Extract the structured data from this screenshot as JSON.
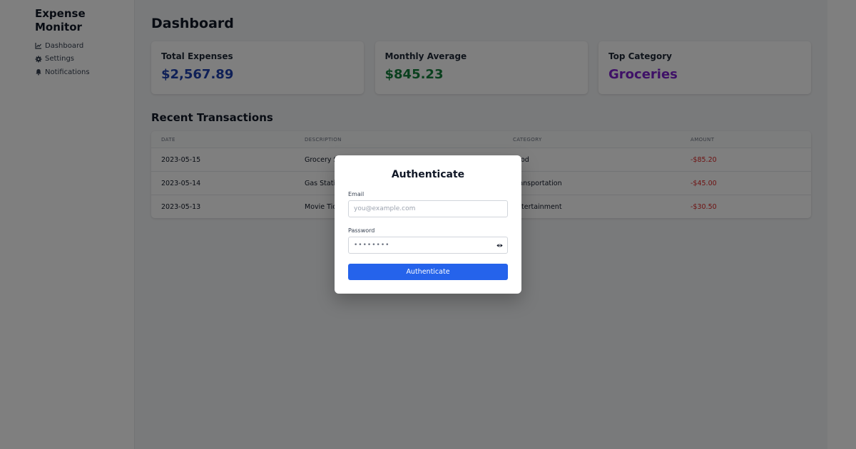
{
  "app": {
    "title": "Expense Monitor"
  },
  "sidebar": {
    "items": [
      {
        "label": "Dashboard",
        "icon": "chart-icon"
      },
      {
        "label": "Settings",
        "icon": "gear-icon"
      },
      {
        "label": "Notifications",
        "icon": "bell-icon"
      }
    ]
  },
  "main": {
    "title": "Dashboard",
    "cards": [
      {
        "label": "Total Expenses",
        "value": "$2,567.89",
        "color": "#1e40af"
      },
      {
        "label": "Monthly Average",
        "value": "$845.23",
        "color": "#15803d"
      },
      {
        "label": "Top Category",
        "value": "Groceries",
        "color": "#7e22ce"
      }
    ],
    "transactions": {
      "title": "Recent Transactions",
      "headers": [
        "Date",
        "Description",
        "Category",
        "Amount"
      ],
      "rows": [
        {
          "date": "2023-05-15",
          "description": "Grocery Store",
          "category": "Food",
          "amount": "-$85.20"
        },
        {
          "date": "2023-05-14",
          "description": "Gas Station",
          "category": "Transportation",
          "amount": "-$45.00"
        },
        {
          "date": "2023-05-13",
          "description": "Movie Tickets",
          "category": "Entertainment",
          "amount": "-$30.50"
        }
      ]
    }
  },
  "modal": {
    "title": "Authenticate",
    "email_label": "Email",
    "email_placeholder": "you@example.com",
    "password_label": "Password",
    "password_value": "••••••••",
    "submit_label": "Authenticate"
  },
  "colors": {
    "accent": "#2563eb",
    "negative": "#dc2626"
  }
}
